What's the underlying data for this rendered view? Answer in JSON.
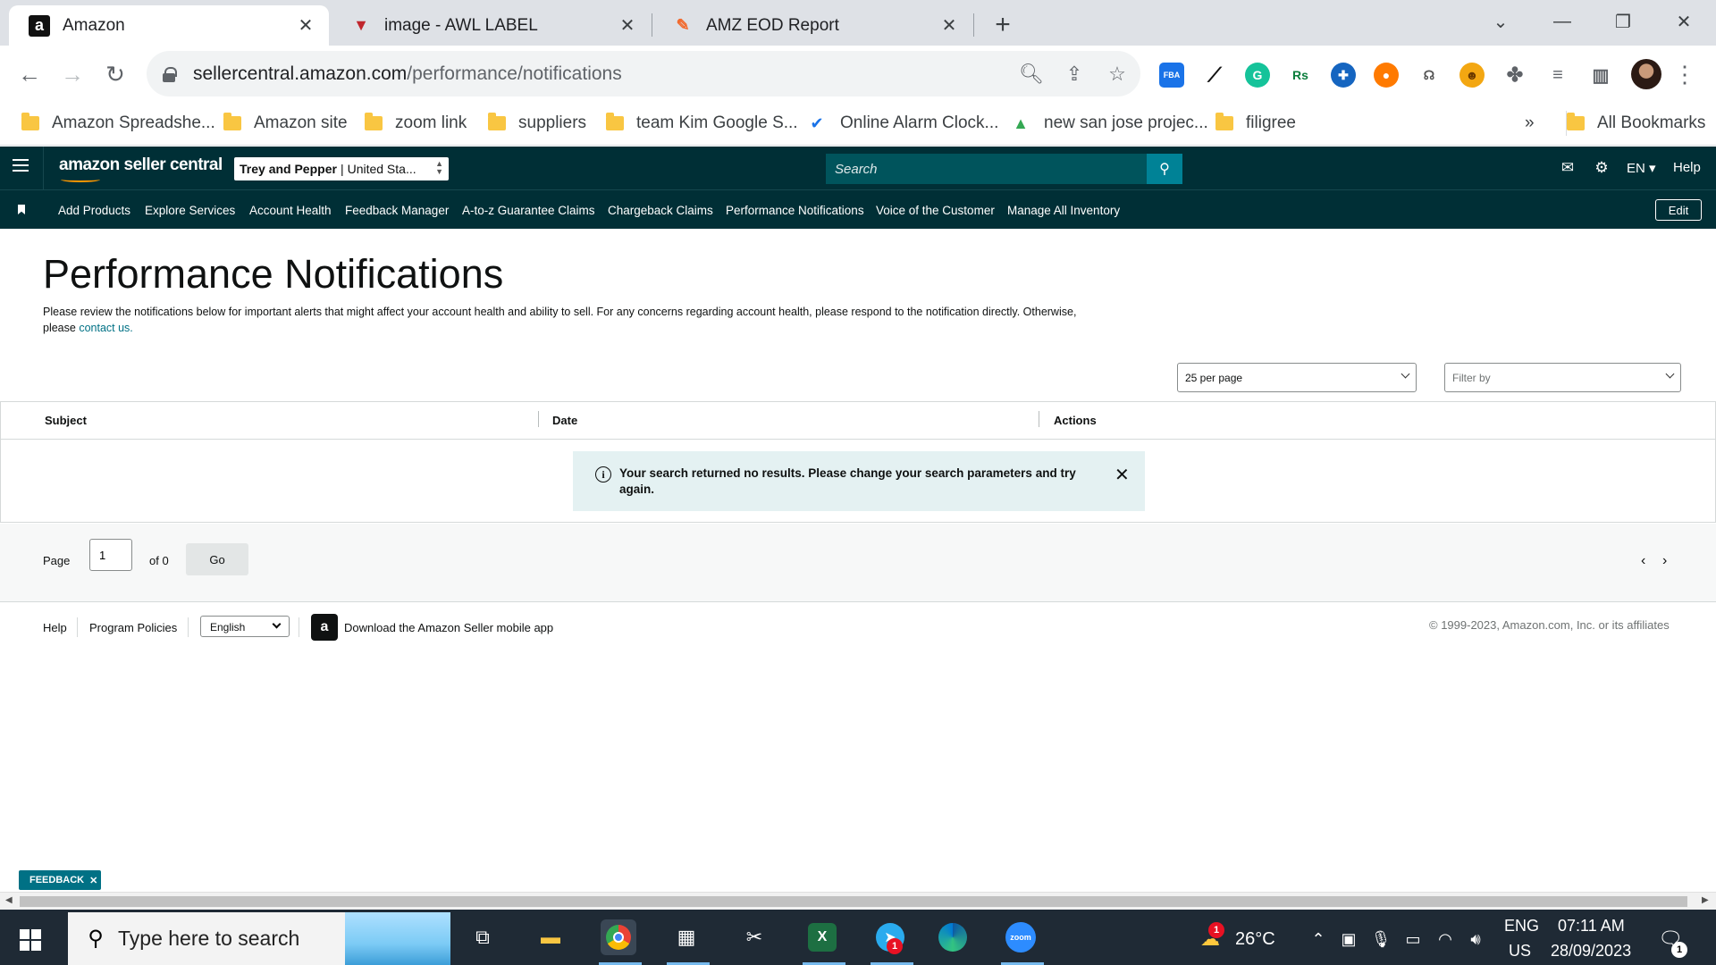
{
  "browser": {
    "tabs": [
      {
        "title": "Amazon",
        "favicon": "a"
      },
      {
        "title": "image - AWL LABEL",
        "favicon": "▼"
      },
      {
        "title": "AMZ EOD Report",
        "favicon": "✎"
      }
    ],
    "url_host": "sellercentral.amazon.com",
    "url_path": "/performance/notifications",
    "bookmarks": [
      {
        "label": "Amazon Spreadshe..."
      },
      {
        "label": "Amazon site"
      },
      {
        "label": "zoom link"
      },
      {
        "label": "suppliers"
      },
      {
        "label": "team Kim Google S..."
      },
      {
        "label": "Online Alarm Clock..."
      },
      {
        "label": "new san jose projec..."
      },
      {
        "label": "filigree"
      }
    ],
    "bookmarks_overflow": "»",
    "all_bookmarks": "All Bookmarks",
    "extensions": {
      "fba": "FBA",
      "rs": "Rs"
    }
  },
  "seller": {
    "logo": "amazon seller central",
    "account": {
      "name": "Trey and Pepper",
      "marketplace": "United Sta..."
    },
    "search_placeholder": "Search",
    "lang": "EN",
    "help": "Help",
    "nav": [
      "Add Products",
      "Explore Services",
      "Account Health",
      "Feedback Manager",
      "A-to-z Guarantee Claims",
      "Chargeback Claims",
      "Performance Notifications",
      "Voice of the Customer",
      "Manage All Inventory"
    ],
    "edit": "Edit"
  },
  "page": {
    "title": "Performance Notifications",
    "desc_1": "Please review the notifications below for important alerts that might affect your account health and ability to sell. For any concerns regarding account health, please respond to the notification directly. Otherwise,",
    "desc_2": "please",
    "contact_link": "contact us.",
    "per_page": "25 per page",
    "filter_placeholder": "Filter by",
    "columns": {
      "subject": "Subject",
      "date": "Date",
      "actions": "Actions"
    },
    "no_results": "Your search returned no results. Please change your search parameters and try again.",
    "pager": {
      "page_label": "Page",
      "page_value": "1",
      "of": "of 0",
      "go": "Go"
    }
  },
  "footer": {
    "help": "Help",
    "policies": "Program Policies",
    "language": "English",
    "app": "Download the Amazon Seller mobile app",
    "copyright": "© 1999-2023, Amazon.com, Inc. or its affiliates"
  },
  "feedback": "FEEDBACK",
  "taskbar": {
    "search_placeholder": "Type here to search",
    "weather": "26°C",
    "lang1": "ENG",
    "lang2": "US",
    "time": "07:11 AM",
    "date": "28/09/2023",
    "notif_count": "1",
    "telegram_count": "1",
    "weather_count": "1"
  }
}
